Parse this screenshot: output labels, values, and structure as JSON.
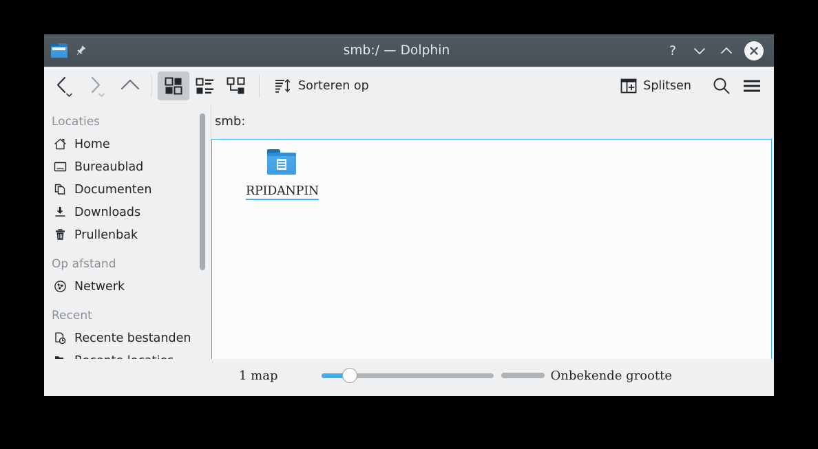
{
  "window": {
    "title": "smb:/ — Dolphin",
    "app_icon": "folder-icon",
    "pin_icon": "pin-icon",
    "buttons": [
      {
        "name": "help-button",
        "icon": "question-mark-icon",
        "label": "?"
      },
      {
        "name": "minimize-button",
        "icon": "chevron-down-icon",
        "label": ""
      },
      {
        "name": "maximize-button",
        "icon": "chevron-up-icon",
        "label": ""
      },
      {
        "name": "close-button",
        "icon": "close-x-icon",
        "label": ""
      }
    ]
  },
  "toolbar": {
    "back_label": "",
    "forward_label": "",
    "up_label": "",
    "view_icons_label": "",
    "view_compact_label": "",
    "view_details_label": "",
    "sort_label": "Sorteren op",
    "split_label": "Splitsen",
    "search_label": "",
    "menu_label": ""
  },
  "sidebar": {
    "sections": [
      {
        "heading": "Locaties",
        "items": [
          {
            "label": "Home",
            "icon": "home-icon"
          },
          {
            "label": "Bureaublad",
            "icon": "desktop-icon"
          },
          {
            "label": "Documenten",
            "icon": "documents-icon"
          },
          {
            "label": "Downloads",
            "icon": "download-icon"
          },
          {
            "label": "Prullenbak",
            "icon": "trash-icon"
          }
        ]
      },
      {
        "heading": "Op afstand",
        "items": [
          {
            "label": "Netwerk",
            "icon": "network-icon"
          }
        ]
      },
      {
        "heading": "Recent",
        "items": [
          {
            "label": "Recente bestanden",
            "icon": "recent-files-icon"
          },
          {
            "label": "Recente locaties",
            "icon": "recent-locations-icon"
          }
        ]
      }
    ]
  },
  "main": {
    "url_label": "smb:",
    "items": [
      {
        "label": "RPIDANPIN",
        "icon": "network-folder-icon"
      }
    ]
  },
  "statusbar": {
    "count_label": "1 map",
    "zoom_value": 14,
    "space_label": "Onbekende grootte"
  },
  "colors": {
    "accent": "#3daee9",
    "titlebar": "#4b545b",
    "window_bg": "#eff0f1",
    "view_bg": "#fcfcfc",
    "text": "#232629",
    "muted_text": "#8d9195"
  }
}
